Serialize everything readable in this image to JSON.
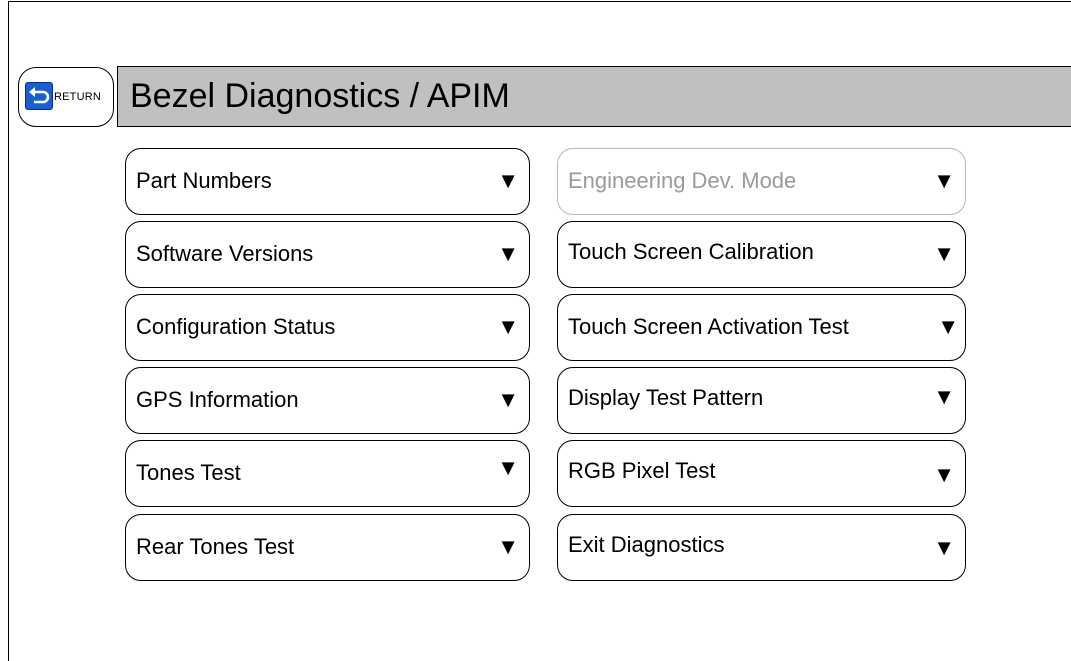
{
  "return_button": {
    "label": "RETURN"
  },
  "header": {
    "title": "Bezel Diagnostics / APIM"
  },
  "arrow_glyph": "▼",
  "left_menu": [
    {
      "label": "Part Numbers"
    },
    {
      "label": "Software Versions"
    },
    {
      "label": "Configuration Status"
    },
    {
      "label": "GPS Information"
    },
    {
      "label": "Tones Test"
    },
    {
      "label": "Rear Tones Test"
    }
  ],
  "right_menu": [
    {
      "label": "Engineering Dev. Mode",
      "disabled": true
    },
    {
      "label": "Touch Screen Calibration"
    },
    {
      "label": "Touch Screen Activation Test"
    },
    {
      "label": "Display Test Pattern"
    },
    {
      "label": "RGB Pixel Test"
    },
    {
      "label": "Exit Diagnostics"
    }
  ]
}
